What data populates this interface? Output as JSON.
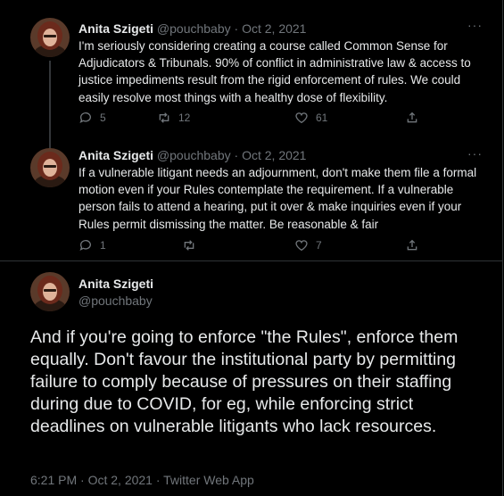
{
  "tweets": [
    {
      "name": "Anita Szigeti",
      "handle": "@pouchbaby",
      "dot": "·",
      "date": "Oct 2, 2021",
      "more": "···",
      "text": "I'm seriously considering creating a course called Common Sense for Adjudicators & Tribunals. 90% of conflict in administrative law & access to justice impediments result from the rigid enforcement of rules. We could easily resolve most things with a healthy dose of flexibility.",
      "replies": "5",
      "retweets": "12",
      "likes": "61"
    },
    {
      "name": "Anita Szigeti",
      "handle": "@pouchbaby",
      "dot": "·",
      "date": "Oct 2, 2021",
      "more": "···",
      "text": "If a vulnerable litigant needs an adjournment, don't make them file a formal motion even if your Rules contemplate the requirement. If a vulnerable person fails to attend a hearing, put it over & make inquiries even if your Rules permit dismissing the matter. Be reasonable & fair",
      "replies": "1",
      "retweets": "",
      "likes": "7"
    }
  ],
  "main": {
    "name": "Anita Szigeti",
    "handle": "@pouchbaby",
    "text": "And if you're going to enforce \"the Rules\", enforce them equally. Don't favour the institutional party by permitting failure to comply because of pressures on their staffing during due to COVID, for eg, while enforcing strict deadlines on vulnerable litigants who lack resources.",
    "meta": "6:21 PM · Oct 2, 2021 · Twitter Web App"
  },
  "icons": {
    "reply": "reply-icon",
    "retweet": "retweet-icon",
    "like": "heart-icon",
    "share": "share-icon"
  },
  "colors": {
    "background": "#000000",
    "text": "#e7e9ea",
    "muted": "#71767b",
    "border": "#2f3336"
  }
}
